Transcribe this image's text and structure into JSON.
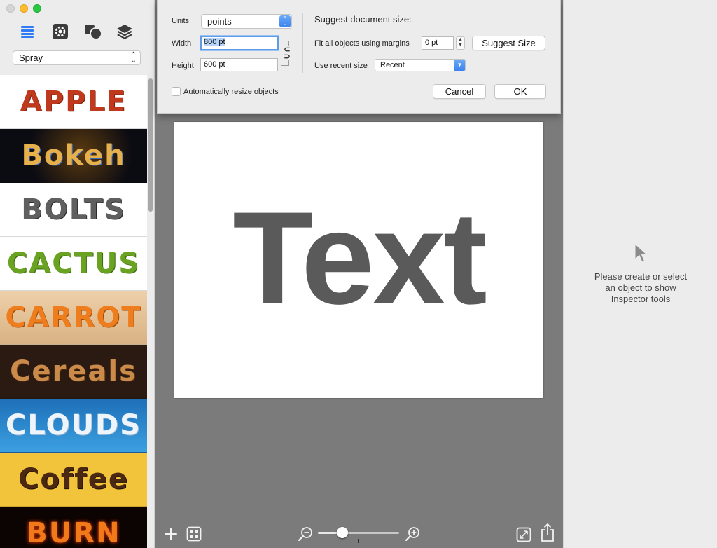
{
  "sidebar": {
    "preset_select": "Spray",
    "styles": [
      {
        "label": "APPLE",
        "bg": "#ffffff",
        "color": "#c0391c"
      },
      {
        "label": "Bokeh",
        "bg": "#0b0b12",
        "color": "#e6b04a"
      },
      {
        "label": "BOLTS",
        "bg": "#ffffff",
        "color": "#5f5f5f"
      },
      {
        "label": "CACTUS",
        "bg": "#ffffff",
        "color": "#6aa322"
      },
      {
        "label": "CARROT",
        "bg": "#e7c59a",
        "color": "#ee7d1d"
      },
      {
        "label": "Cereals",
        "bg": "#2a1a12",
        "color": "#c98a4a"
      },
      {
        "label": "CLOUDS",
        "bg": "#2f8fd2",
        "color": "#eef4fb"
      },
      {
        "label": "Coffee",
        "bg": "#f1c43b",
        "color": "#4a2812"
      },
      {
        "label": "BURN",
        "bg": "#0c0402",
        "color": "#f07a1a"
      }
    ]
  },
  "dialog": {
    "units_label": "Units",
    "units_value": "points",
    "width_label": "Width",
    "width_value": "800 pt",
    "height_label": "Height",
    "height_value": "600 pt",
    "suggest_title": "Suggest document size:",
    "fit_label": "Fit all objects using margins",
    "margin_value": "0 pt",
    "suggest_button": "Suggest Size",
    "recent_label": "Use recent size",
    "recent_value": "Recent",
    "auto_resize_label": "Automatically resize objects",
    "cancel_button": "Cancel",
    "ok_button": "OK"
  },
  "canvas": {
    "text": "Text",
    "zoom_level": 0.3
  },
  "inspector": {
    "line1": "Please create or select",
    "line2": "an object to show",
    "line3": "Inspector tools"
  }
}
